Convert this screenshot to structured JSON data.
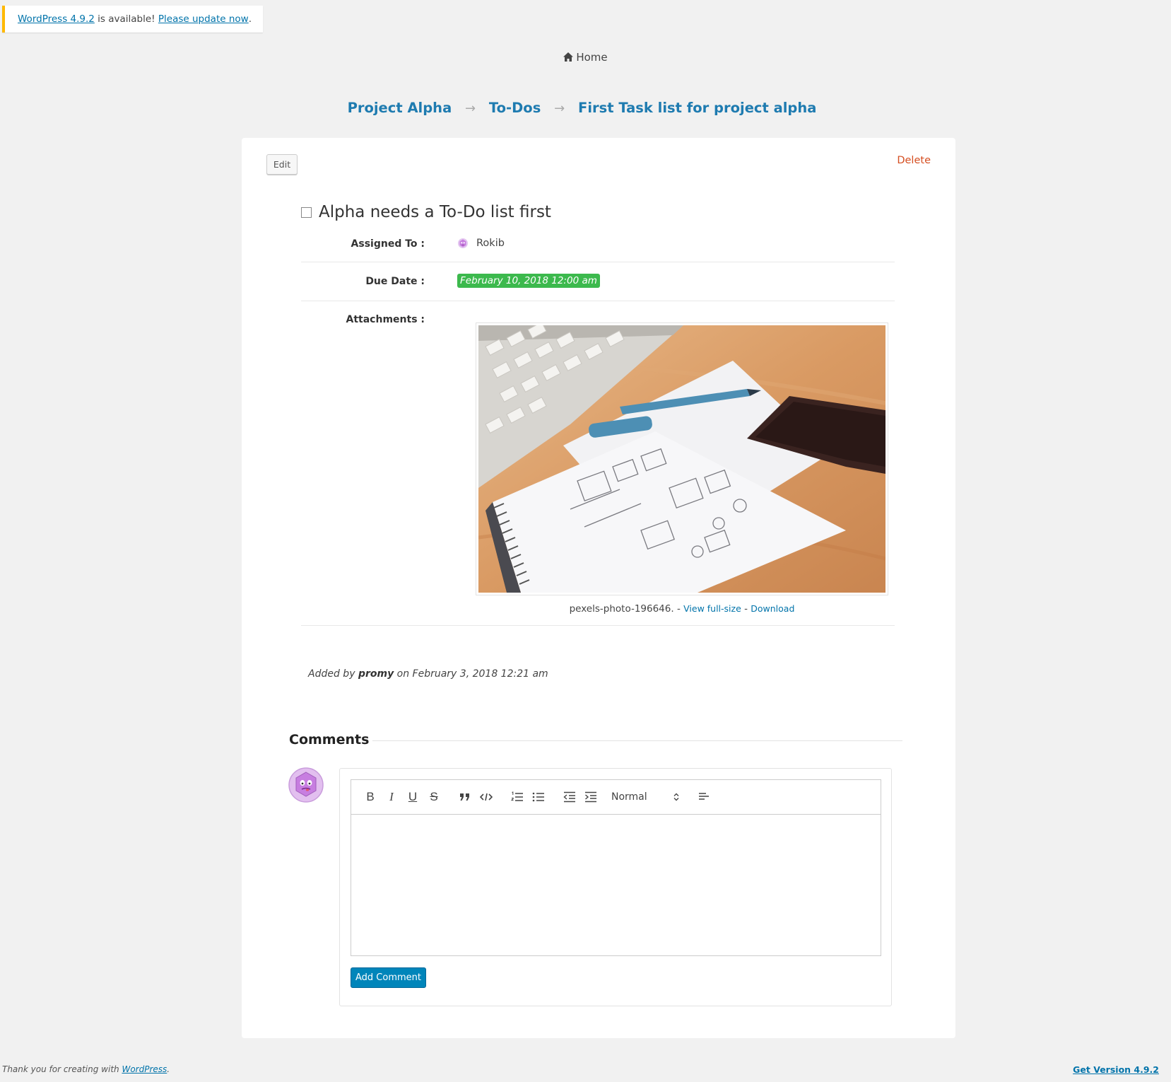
{
  "notice": {
    "version_link": "WordPress 4.9.2",
    "middle_text": " is available! ",
    "update_link": "Please update now",
    "end_text": "."
  },
  "home": {
    "label": "Home",
    "icon": "home-icon"
  },
  "breadcrumb": {
    "items": [
      "Project Alpha",
      "To-Dos",
      "First Task list for project alpha"
    ],
    "separator": "→"
  },
  "task": {
    "edit_label": "Edit",
    "delete_label": "Delete",
    "title": "Alpha needs a To-Do list first",
    "assigned_label": "Assigned To :",
    "assignee": "Rokib",
    "due_label": "Due Date :",
    "due_date": "February 10, 2018 12:00 am",
    "due_badge_color": "#3cb94d",
    "attachments_label": "Attachments :",
    "attachment": {
      "file_name": "pexels-photo-196646.",
      "sep1": " - ",
      "view_label": "View full-size",
      "sep2": " - ",
      "download_label": "Download"
    },
    "added_prefix": "Added by ",
    "added_user": "promy",
    "added_suffix": " on February 3, 2018 12:21 am"
  },
  "comments": {
    "heading": "Comments",
    "toolbar": {
      "bold": "B",
      "italic": "I",
      "underline": "U",
      "strike": "S",
      "heading_select": "Normal",
      "icons": [
        "bold-icon",
        "italic-icon",
        "underline-icon",
        "strikethrough-icon",
        "blockquote-icon",
        "code-icon",
        "ordered-list-icon",
        "bullet-list-icon",
        "outdent-icon",
        "indent-icon",
        "align-icon"
      ]
    },
    "add_button": "Add Comment",
    "button_color": "#0085ba"
  },
  "footer": {
    "left_prefix": "Thank you for creating with ",
    "left_link": "WordPress",
    "left_suffix": ".",
    "right_link": "Get Version 4.9.2"
  }
}
